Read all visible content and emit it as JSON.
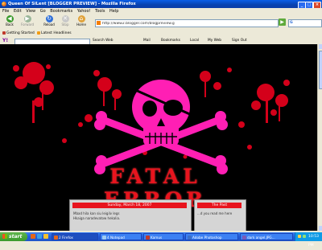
{
  "window": {
    "title": "Queen Of SiLent [BLOGGER PREVIEW] - Mozilla Firefox",
    "buttons": [
      "_",
      "□",
      "×"
    ]
  },
  "menu": [
    "File",
    "Edit",
    "View",
    "Go",
    "Bookmarks",
    "Yahoo!",
    "Tools",
    "Help"
  ],
  "nav": {
    "back": "Back",
    "forward": "Forward",
    "reload": "Reload",
    "stop": "Stop",
    "home": "Home",
    "url": "http://www2.blogger.com/blogpreview.g",
    "go": "▶",
    "search_placeholder": "G"
  },
  "bookmarks": [
    "Getting Started",
    "Latest Headlines"
  ],
  "yahoo": {
    "logo": "Y!",
    "items": [
      "Search Web",
      "Mail",
      "Bookmarks",
      "Local",
      "My Web",
      "Sign Out"
    ]
  },
  "page": {
    "heading": "FATAL ERROR",
    "post": {
      "date": "Sunday, March 18, 2007",
      "line1": "Mbad hila kan siu leigilv legs",
      "line2": "Hkaiga naradevatow hekalia."
    },
    "sidebar": {
      "heading": "The Past",
      "text": "...d you read me here"
    },
    "colors": {
      "skull": "#ff1fb4",
      "splatter": "#d4001a",
      "heading": "#e8141e"
    }
  },
  "taskbar": {
    "start": "start",
    "tasks": [
      "2 Firefox",
      "4 Notepad",
      "Kamus",
      "Adobe Photoshop",
      "dark angel.JPG..."
    ],
    "clock": "10:53 PM"
  }
}
